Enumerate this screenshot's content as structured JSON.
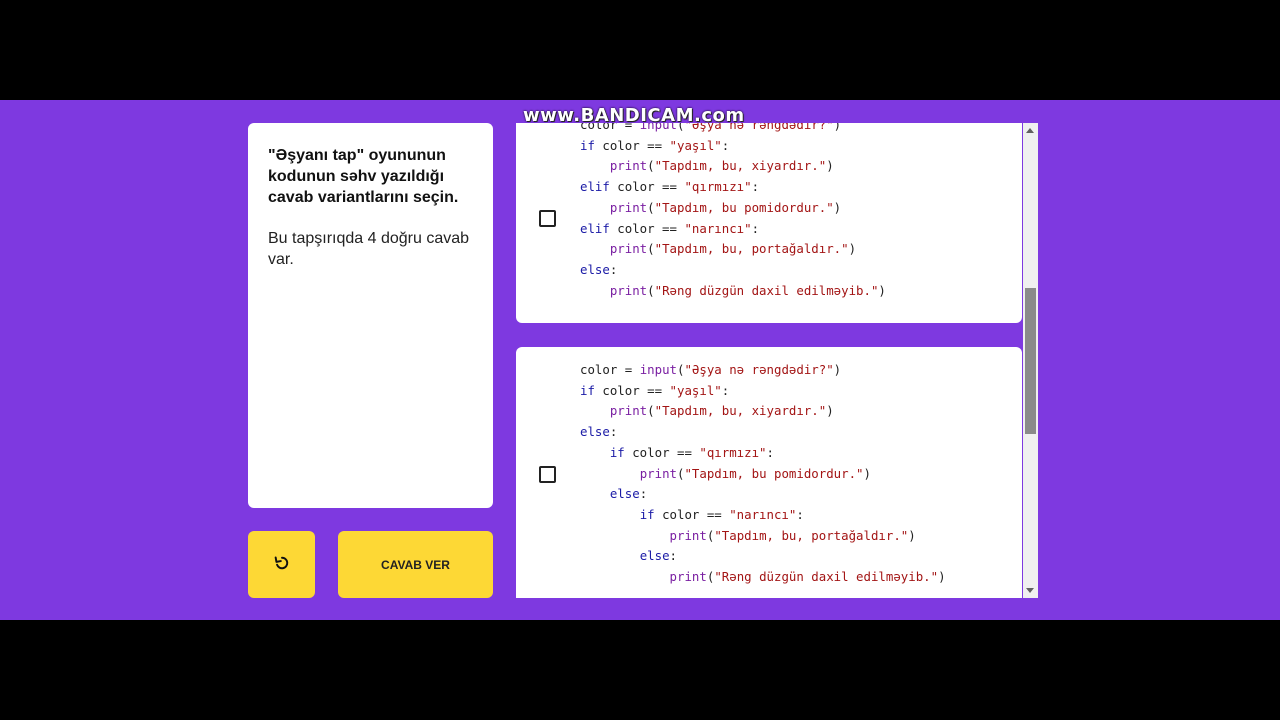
{
  "watermark": "www.BANDICAM.com",
  "question": {
    "title": "\"Əşyanı tap\" oyununun kodunun səhv yazıldığı cavab variantlarını seçin.",
    "note": "Bu tapşırıqda 4 doğru cavab var."
  },
  "buttons": {
    "reset_icon": "undo-icon",
    "answer_label": "CAVAB VER"
  },
  "options": [
    {
      "checked": false,
      "code": [
        "color = input(\"Əşya nə rəngdədir?\")",
        "if color == \"yaşıl\":",
        "    print(\"Tapdım, bu, xiyardır.\")",
        "elif color == \"qırmızı\":",
        "    print(\"Tapdım, bu pomidordur.\")",
        "elif color == \"narıncı\":",
        "    print(\"Tapdım, bu, portağaldır.\")",
        "else:",
        "    print(\"Rəng düzgün daxil edilməyib.\")"
      ]
    },
    {
      "checked": false,
      "code": [
        "color = input(\"Əşya nə rəngdədir?\")",
        "if color == \"yaşıl\":",
        "    print(\"Tapdım, bu, xiyardır.\")",
        "else:",
        "    if color == \"qırmızı\":",
        "        print(\"Tapdım, bu pomidordur.\")",
        "    else:",
        "        if color == \"narıncı\":",
        "            print(\"Tapdım, bu, portağaldır.\")",
        "        else:",
        "            print(\"Rəng düzgün daxil edilməyib.\")"
      ]
    }
  ],
  "colors": {
    "background": "#7e39e0",
    "button": "#fdd835"
  }
}
